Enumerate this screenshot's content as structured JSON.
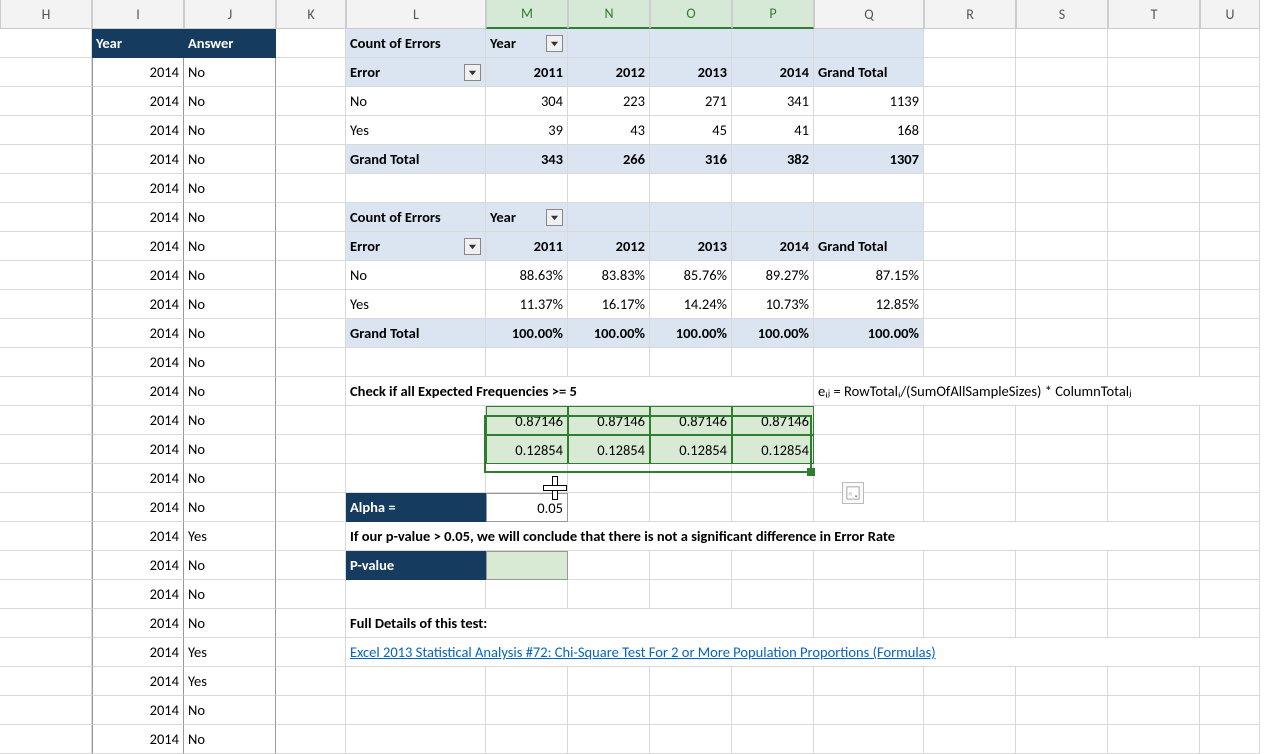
{
  "cols": [
    "H",
    "I",
    "J",
    "K",
    "L",
    "M",
    "N",
    "O",
    "P",
    "Q",
    "R",
    "S",
    "T",
    "U"
  ],
  "sel_cols": [
    "M",
    "N",
    "O",
    "P"
  ],
  "left_header": {
    "year": "Year",
    "answer": "Answer"
  },
  "left_rows": [
    {
      "y": "2014",
      "a": "No"
    },
    {
      "y": "2014",
      "a": "No"
    },
    {
      "y": "2014",
      "a": "No"
    },
    {
      "y": "2014",
      "a": "No"
    },
    {
      "y": "2014",
      "a": "No"
    },
    {
      "y": "2014",
      "a": "No"
    },
    {
      "y": "2014",
      "a": "No"
    },
    {
      "y": "2014",
      "a": "No"
    },
    {
      "y": "2014",
      "a": "No"
    },
    {
      "y": "2014",
      "a": "No"
    },
    {
      "y": "2014",
      "a": "No"
    },
    {
      "y": "2014",
      "a": "No"
    },
    {
      "y": "2014",
      "a": "No"
    },
    {
      "y": "2014",
      "a": "No"
    },
    {
      "y": "2014",
      "a": "No"
    },
    {
      "y": "2014",
      "a": "No"
    },
    {
      "y": "2014",
      "a": "Yes"
    },
    {
      "y": "2014",
      "a": "No"
    },
    {
      "y": "2014",
      "a": "No"
    },
    {
      "y": "2014",
      "a": "No"
    },
    {
      "y": "2014",
      "a": "Yes"
    },
    {
      "y": "2014",
      "a": "Yes"
    },
    {
      "y": "2014",
      "a": "No"
    },
    {
      "y": "2014",
      "a": "No"
    }
  ],
  "pivot1": {
    "title": "Count of Errors",
    "colfield": "Year",
    "rowfield": "Error",
    "cols": [
      "2011",
      "2012",
      "2013",
      "2014"
    ],
    "gt": "Grand Total",
    "rows": [
      {
        "lbl": "No",
        "v": [
          "304",
          "223",
          "271",
          "341"
        ],
        "t": "1139"
      },
      {
        "lbl": "Yes",
        "v": [
          "39",
          "43",
          "45",
          "41"
        ],
        "t": "168"
      }
    ],
    "totals": {
      "lbl": "Grand Total",
      "v": [
        "343",
        "266",
        "316",
        "382"
      ],
      "t": "1307"
    }
  },
  "pivot2": {
    "title": "Count of Errors",
    "colfield": "Year",
    "rowfield": "Error",
    "cols": [
      "2011",
      "2012",
      "2013",
      "2014"
    ],
    "gt": "Grand Total",
    "rows": [
      {
        "lbl": "No",
        "v": [
          "88.63%",
          "83.83%",
          "85.76%",
          "89.27%"
        ],
        "t": "87.15%"
      },
      {
        "lbl": "Yes",
        "v": [
          "11.37%",
          "16.17%",
          "14.24%",
          "10.73%"
        ],
        "t": "12.85%"
      }
    ],
    "totals": {
      "lbl": "Grand Total",
      "v": [
        "100.00%",
        "100.00%",
        "100.00%",
        "100.00%"
      ],
      "t": "100.00%"
    }
  },
  "check_label": "Check if all Expected Frequencies >= 5",
  "formula": "eᵢⱼ = RowTotalᵢ/(SumOfAllSampleSizes) * ColumnTotalⱼ",
  "expected": [
    [
      "0.87146",
      "0.87146",
      "0.87146",
      "0.87146"
    ],
    [
      "0.12854",
      "0.12854",
      "0.12854",
      "0.12854"
    ]
  ],
  "alpha_label": "Alpha =",
  "alpha_val": "0.05",
  "conclusion": "If our p-value > 0.05, we will conclude that there is not a significant difference in Error Rate",
  "pvalue_label": "P-value",
  "details_label": "Full Details of this test:",
  "link": "Excel 2013 Statistical Analysis #72: Chi-Square Test For 2 or More Population Proportions (Formulas)",
  "chart_data": {
    "type": "table",
    "title": "Count of Errors by Year",
    "categories": [
      "2011",
      "2012",
      "2013",
      "2014"
    ],
    "series": [
      {
        "name": "No",
        "values": [
          304,
          223,
          271,
          341
        ]
      },
      {
        "name": "Yes",
        "values": [
          39,
          43,
          45,
          41
        ]
      }
    ],
    "grand_total": 1307
  }
}
